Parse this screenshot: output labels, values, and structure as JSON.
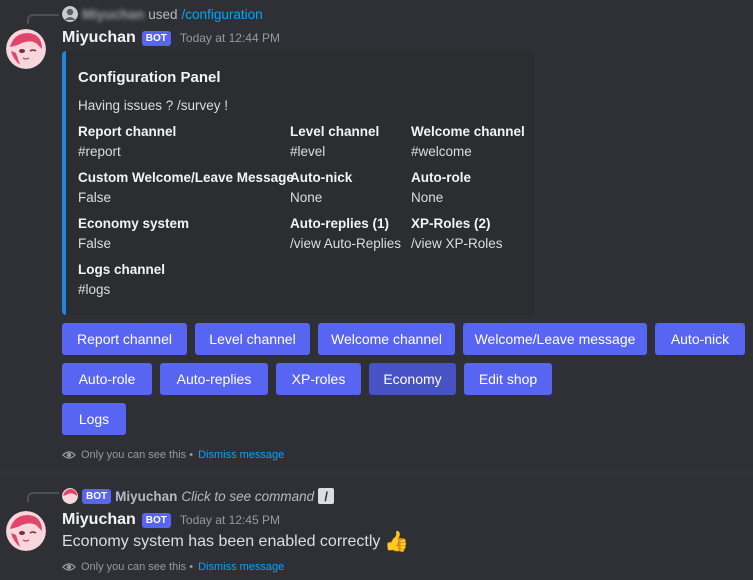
{
  "message1": {
    "reply": {
      "user_name": "Miyuchan",
      "used_text": "used",
      "command": "/configuration"
    },
    "author": "Miyuchan",
    "bot_tag": "BOT",
    "timestamp": "Today at 12:44 PM",
    "embed": {
      "accent_color": "#1f85de",
      "title": "Configuration Panel",
      "description": "Having issues ? /survey !",
      "fields": [
        {
          "name": "Report channel",
          "value": "#report"
        },
        {
          "name": "Level channel",
          "value": "#level"
        },
        {
          "name": "Welcome channel",
          "value": "#welcome"
        },
        {
          "name": "Custom Welcome/Leave Message",
          "value": "False"
        },
        {
          "name": "Auto-nick",
          "value": "None"
        },
        {
          "name": "Auto-role",
          "value": "None"
        },
        {
          "name": "Economy system",
          "value": "False"
        },
        {
          "name": "Auto-replies (1)",
          "value": "/view Auto-Replies"
        },
        {
          "name": "XP-Roles (2)",
          "value": "/view XP-Roles"
        },
        {
          "name": "Logs channel",
          "value": "#logs"
        }
      ]
    },
    "buttons": [
      "Report channel",
      "Level channel",
      "Welcome channel",
      "Welcome/Leave message",
      "Auto-nick",
      "Auto-role",
      "Auto-replies",
      "XP-roles",
      "Economy",
      "Edit shop",
      "Logs"
    ],
    "ephemeral_note": "Only you can see this •",
    "dismiss_label": "Dismiss message"
  },
  "message2": {
    "reply": {
      "bot_tag": "BOT",
      "user_name": "Miyuchan",
      "click_text": "Click to see command"
    },
    "author": "Miyuchan",
    "bot_tag": "BOT",
    "timestamp": "Today at 12:45 PM",
    "content": "Economy system has been enabled correctly",
    "emoji": "👍",
    "ephemeral_note": "Only you can see this •",
    "dismiss_label": "Dismiss message"
  },
  "colors": {
    "blurple": "#5865f2",
    "link": "#00a8fc",
    "background": "#313338"
  }
}
